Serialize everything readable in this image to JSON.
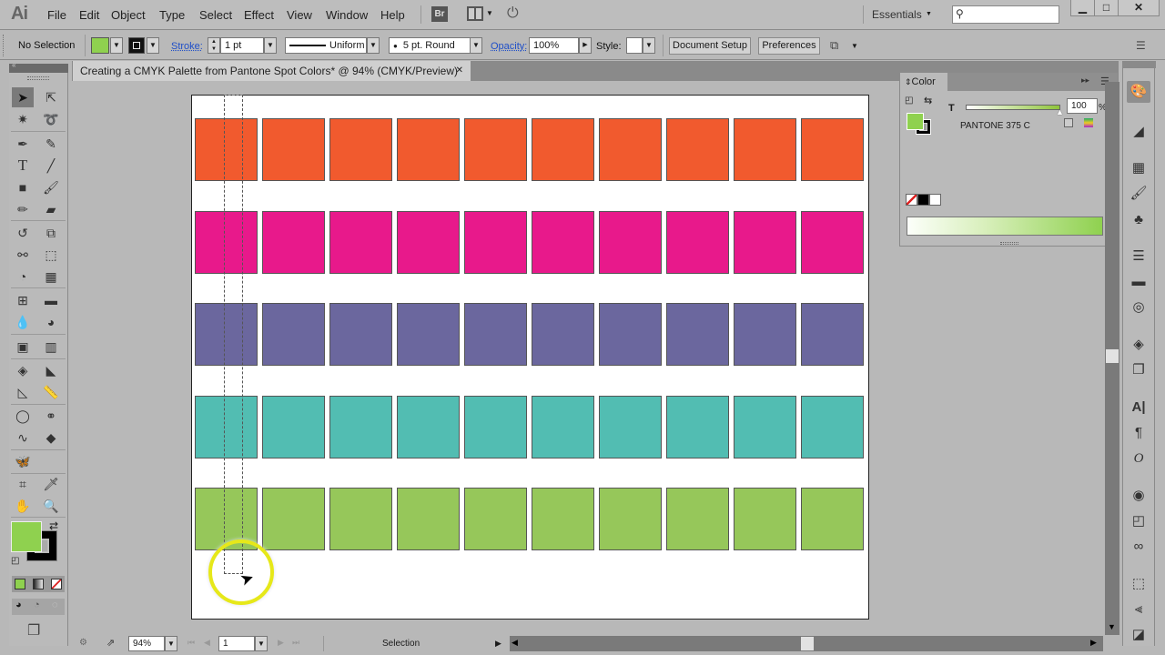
{
  "app": {
    "logo": "Ai"
  },
  "menu": [
    "File",
    "Edit",
    "Object",
    "Type",
    "Select",
    "Effect",
    "View",
    "Window",
    "Help"
  ],
  "menubar_right": {
    "bridge_label": "Br",
    "workspace": "Essentials",
    "search_placeholder": ""
  },
  "window_buttons": {
    "minimize": "▁",
    "maximize": "□",
    "close": "✕"
  },
  "control_bar": {
    "selection": "No Selection",
    "stroke_label": "Stroke:",
    "stroke_weight": "1 pt",
    "stroke_profile": "Uniform",
    "brush": "5 pt. Round",
    "opacity_label": "Opacity:",
    "opacity": "100%",
    "style_label": "Style:",
    "document_setup": "Document Setup",
    "preferences": "Preferences",
    "fill_color": "#8fd14f"
  },
  "document": {
    "tab_title": "Creating a CMYK Palette from Pantone Spot Colors* @ 94% (CMYK/Preview)",
    "close": "✕"
  },
  "artboard": {
    "rows": [
      {
        "color": "#f15a2e"
      },
      {
        "color": "#e8198b"
      },
      {
        "color": "#6b679e"
      },
      {
        "color": "#52bdb2"
      },
      {
        "color": "#96c75a"
      }
    ],
    "columns": 10
  },
  "color_panel": {
    "title": "Color",
    "tint_label": "T",
    "tint_value": "100",
    "tint_unit": "%",
    "tint_fraction": 1.0,
    "swatch_name": "PANTONE 375 C",
    "fill_color": "#8fd14f"
  },
  "tools_panel": {
    "fill_color": "#8fd14f",
    "stroke_color": "#000000"
  },
  "status_bar": {
    "zoom": "94%",
    "artboard_number": "1",
    "tool_status": "Selection"
  }
}
